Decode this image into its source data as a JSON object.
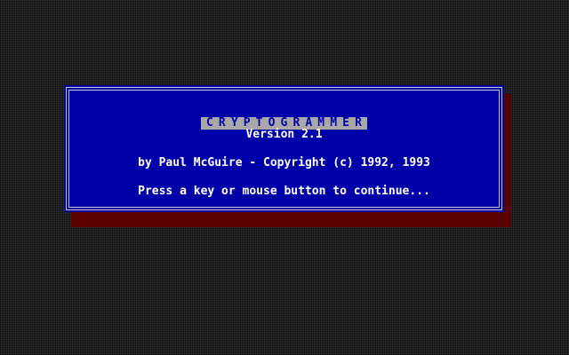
{
  "splash": {
    "app_title": "CRYPTOGRAMMER",
    "version": "Version 2.1",
    "credit": "by Paul McGuire - Copyright (c) 1992, 1993",
    "prompt": "Press a key or mouse button to continue..."
  },
  "colors": {
    "desktop_background": "#2f2f2f",
    "dialog_background": "#0000a8",
    "dialog_border": "#c8c8c8",
    "dialog_shadow": "#5a0000",
    "title_highlight": "#a8a8a8",
    "title_text": "#0000a8",
    "body_text": "#ffffff"
  }
}
